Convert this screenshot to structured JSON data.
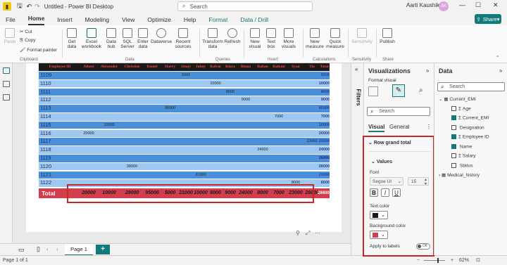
{
  "titlebar": {
    "title": "Untitled - Power BI Desktop",
    "search_placeholder": "Search",
    "user": "Aarti Kaushik",
    "avatar_initials": "AK"
  },
  "menu": {
    "tabs": [
      "File",
      "Home",
      "Insert",
      "Modeling",
      "View",
      "Optimize",
      "Help",
      "Format",
      "Data / Drill"
    ],
    "share": "Share"
  },
  "ribbon": {
    "paste": "Paste",
    "cut": "Cut",
    "copy": "Copy",
    "format_painter": "Format painter",
    "get_data": "Get data",
    "excel_workbook": "Excel workbook",
    "data_hub": "Data hub",
    "sql_server": "SQL Server",
    "enter_data": "Enter data",
    "dataverse": "Dataverse",
    "recent_sources": "Recent sources",
    "transform_data": "Transform data",
    "refresh": "Refresh",
    "new_visual": "New visual",
    "text_box": "Text box",
    "more_visuals": "More visuals",
    "new_measure": "New measure",
    "quick_measure": "Quick measure",
    "sensitivity": "Sensitivity",
    "publish": "Publish",
    "groups": {
      "clipboard": "Clipboard",
      "data": "Data",
      "queries": "Queries",
      "insert": "Insert",
      "calculations": "Calculations",
      "sensitivity": "Sensitivity",
      "share": "Share"
    }
  },
  "matrix": {
    "columns": [
      "Employee ID",
      "Albert",
      "Alexender",
      "Christine",
      "Daniel",
      "Harry",
      "Jenny",
      "Johny",
      "Kelvin",
      "Klara",
      "Rinna",
      "Rohan",
      "Ruhani",
      "Syan",
      "Tia",
      "Total"
    ],
    "rows": [
      {
        "id": "1109",
        "col": 6,
        "val": "5000",
        "total": "5000"
      },
      {
        "id": "1110",
        "col": 8,
        "val": "10000",
        "total": "10000"
      },
      {
        "id": "1111",
        "col": 9,
        "val": "8000",
        "total": "8000"
      },
      {
        "id": "1112",
        "col": 10,
        "val": "9000",
        "total": "9000"
      },
      {
        "id": "1113",
        "col": 5,
        "val": "95000",
        "total": "95000"
      },
      {
        "id": "1114",
        "col": 12,
        "val": "7000",
        "total": "7000"
      },
      {
        "id": "1115",
        "col": 2,
        "val": "10000",
        "total": "10000"
      },
      {
        "id": "1116",
        "col": 1,
        "val": "20000",
        "total": "20000"
      },
      {
        "id": "1117",
        "col": 14,
        "val": "23000",
        "total": "23000"
      },
      {
        "id": "1118",
        "col": 11,
        "val": "24000",
        "total": "24000"
      },
      {
        "id": "1119",
        "col": 15,
        "val": "26000",
        "total": "26000"
      },
      {
        "id": "1120",
        "col": 3,
        "val": "28000",
        "total": "28000"
      },
      {
        "id": "1121",
        "col": 7,
        "val": "21000",
        "total": "21000"
      },
      {
        "id": "1122",
        "col": 13,
        "val": "8000",
        "total": "8000"
      }
    ],
    "total_label": "Total",
    "totals": [
      "20000",
      "10000",
      "28000",
      "95000",
      "5000",
      "21000",
      "10000",
      "8000",
      "9000",
      "24000",
      "8000",
      "7000",
      "23000",
      "26000",
      "294000"
    ]
  },
  "pages": {
    "current": "Page 1",
    "add": "+"
  },
  "status": {
    "left": "Page 1 of 1",
    "zoom": "62%"
  },
  "filters": {
    "label": "Filters"
  },
  "viz": {
    "title": "Visualizations",
    "format_visual": "Format visual",
    "search_placeholder": "Search",
    "tab_visual": "Visual",
    "tab_general": "General",
    "section": "Row grand total",
    "subsection": "Values",
    "font_label": "Font",
    "font_value": "Segoe UI",
    "font_size": "15",
    "bold": "B",
    "italic": "I",
    "underline": "U",
    "text_color_label": "Text color",
    "text_color": "#1a1a1a",
    "bg_color_label": "Background color",
    "bg_color": "#d33e4e",
    "apply_label": "Apply to labels",
    "toggle": "Off"
  },
  "data": {
    "title": "Data",
    "search_placeholder": "Search",
    "tables": [
      {
        "name": "Current_EMI",
        "fields": [
          {
            "name": "Age",
            "sigma": true,
            "checked": false
          },
          {
            "name": "Current_EMI",
            "sigma": true,
            "checked": true
          },
          {
            "name": "Designation",
            "sigma": false,
            "checked": false
          },
          {
            "name": "Employee ID",
            "sigma": true,
            "checked": true
          },
          {
            "name": "Name",
            "sigma": false,
            "checked": true
          },
          {
            "name": "Salary",
            "sigma": true,
            "checked": false
          },
          {
            "name": "Status",
            "sigma": false,
            "checked": false
          }
        ]
      },
      {
        "name": "Medical_history",
        "fields": []
      }
    ]
  }
}
